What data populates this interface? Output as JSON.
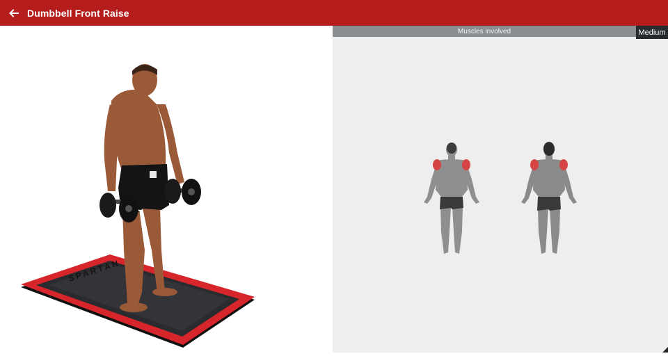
{
  "app_bar": {
    "title": "Dumbbell Front Raise",
    "back_icon": "arrow-left-icon",
    "background": "#b51c1c"
  },
  "exercise_illustration": {
    "mat_text": "SPARTAN"
  },
  "muscles_panel": {
    "header": "Muscles involved",
    "difficulty": "Medium",
    "highlight_color": "#d64545",
    "views": [
      "front",
      "back"
    ]
  }
}
